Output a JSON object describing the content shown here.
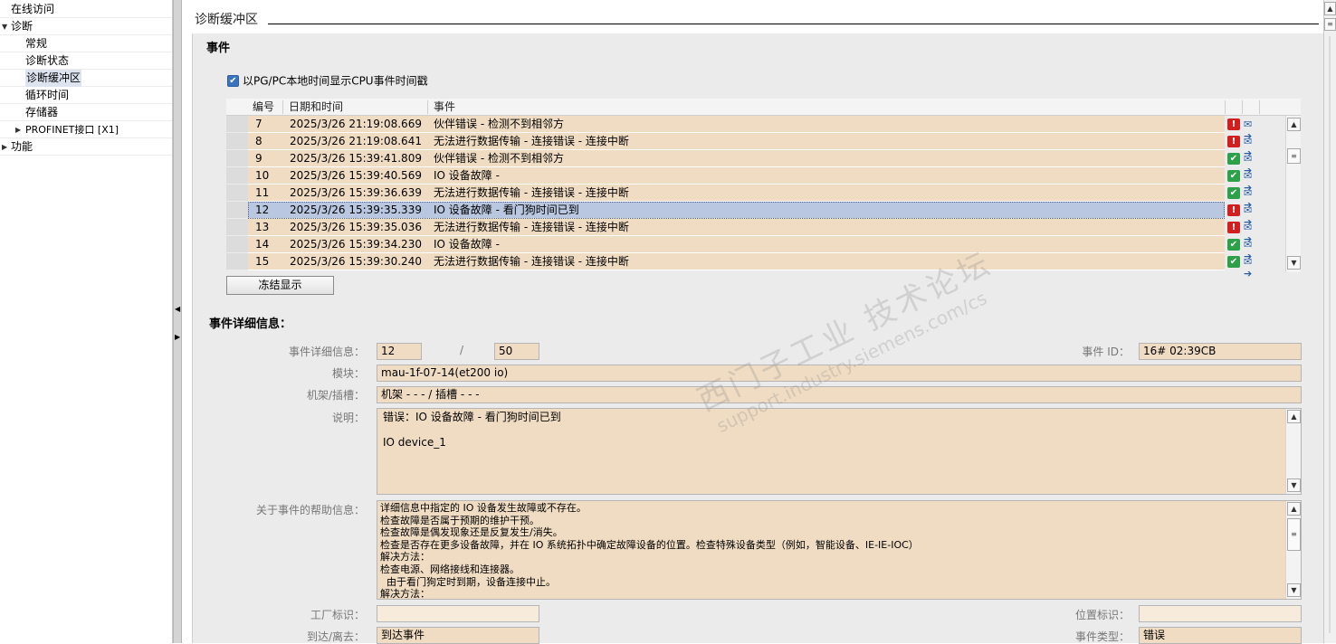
{
  "tree": {
    "items": [
      {
        "label": "在线访问",
        "arrow": ""
      },
      {
        "label": "诊断",
        "arrow": "▼"
      },
      {
        "label": "常规",
        "arrow": ""
      },
      {
        "label": "诊断状态",
        "arrow": ""
      },
      {
        "label": "诊断缓冲区",
        "arrow": ""
      },
      {
        "label": "循环时间",
        "arrow": ""
      },
      {
        "label": "存储器",
        "arrow": ""
      },
      {
        "label": "PROFINET接口 [X1]",
        "arrow": "▶"
      },
      {
        "label": "功能",
        "arrow": "▶"
      }
    ]
  },
  "page_title": "诊断缓冲区",
  "events": {
    "heading": "事件",
    "checkbox_label": "以PG/PC本地时间显示CPU事件时间戳",
    "checkbox_checked": true,
    "columns": {
      "num": "编号",
      "datetime": "日期和时间",
      "event": "事件"
    },
    "rows": [
      {
        "num": "7",
        "datetime": "2025/3/26 21:19:08.669",
        "event": "伙伴错误  - 检测不到相邻方",
        "status": "error"
      },
      {
        "num": "8",
        "datetime": "2025/3/26 21:19:08.641",
        "event": "无法进行数据传输  - 连接错误 - 连接中断",
        "status": "error"
      },
      {
        "num": "9",
        "datetime": "2025/3/26 15:39:41.809",
        "event": "伙伴错误  - 检测不到相邻方",
        "status": "ok"
      },
      {
        "num": "10",
        "datetime": "2025/3/26 15:39:40.569",
        "event": "IO 设备故障 -",
        "status": "ok"
      },
      {
        "num": "11",
        "datetime": "2025/3/26 15:39:36.639",
        "event": "无法进行数据传输  - 连接错误 - 连接中断",
        "status": "ok"
      },
      {
        "num": "12",
        "datetime": "2025/3/26 15:39:35.339",
        "event": "IO 设备故障 - 看门狗时间已到",
        "status": "error",
        "selected": true
      },
      {
        "num": "13",
        "datetime": "2025/3/26 15:39:35.036",
        "event": "无法进行数据传输  - 连接错误 - 连接中断",
        "status": "error"
      },
      {
        "num": "14",
        "datetime": "2025/3/26 15:39:34.230",
        "event": "IO 设备故障 -",
        "status": "ok"
      },
      {
        "num": "15",
        "datetime": "2025/3/26 15:39:30.240",
        "event": "无法进行数据传输  - 连接错误 - 连接中断",
        "status": "ok"
      }
    ],
    "freeze_button": "冻结显示"
  },
  "details": {
    "heading": "事件详细信息：",
    "detail_label": "事件详细信息：",
    "detail_index": "12",
    "detail_sep": "/",
    "detail_total": "50",
    "event_id_label": "事件 ID：",
    "event_id": "16# 02:39CB",
    "module_label": "模块：",
    "module": "mau-1f-07-14(et200 io)",
    "rack_label": "机架/插槽：",
    "rack": "机架 - - - / 插槽 - - -",
    "desc_label": "说明：",
    "desc_lines": [
      "错误：IO 设备故障 - 看门狗时间已到",
      "",
      "IO device_1"
    ],
    "help_label": "关于事件的帮助信息：",
    "help_lines": [
      "详细信息中指定的 IO 设备发生故障或不存在。",
      "检查故障是否属于预期的维护干预。",
      "检查故障是偶发现象还是反复发生/消失。",
      "检查是否存在更多设备故障，并在 IO 系统拓扑中确定故障设备的位置。检查特殊设备类型（例如，智能设备、IE-IE-IOC）",
      "解决方法：",
      "检查电源、网络接线和连接器。",
      "  由于看门狗定时到期，设备连接中止。",
      "解决方法："
    ],
    "plant_label": "工厂标识：",
    "plant": "",
    "location_label": "位置标识：",
    "location": "",
    "arrive_label": "到达/离去：",
    "arrive": "到达事件",
    "type_label": "事件类型：",
    "type": "错误"
  },
  "watermark": {
    "line1": "西门子工业 技术论坛",
    "line2": "support.industry.siemens.com/cs"
  }
}
